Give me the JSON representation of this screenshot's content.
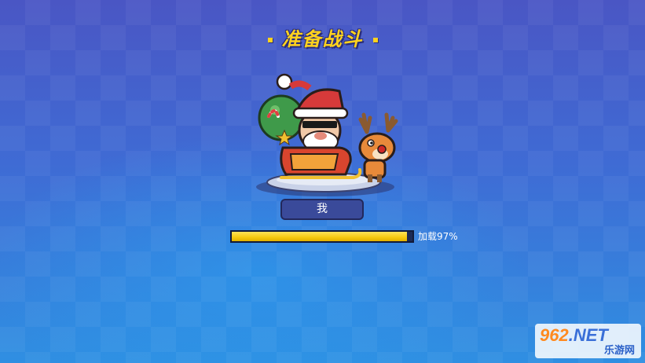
{
  "title": "准备战斗",
  "player": {
    "name": "我"
  },
  "loading": {
    "text": "加载97%",
    "progress": 0.97
  },
  "watermark": {
    "brand_num": "962",
    "brand_domain": ".NET",
    "site_name": "乐游网"
  },
  "colors": {
    "title": "#ffd21e",
    "progress_fill": "#f6c90e",
    "background_top": "#4a56c4",
    "background_bottom": "#2f8fe2"
  },
  "icons": [
    "santa-sleigh-character",
    "reindeer-character"
  ]
}
